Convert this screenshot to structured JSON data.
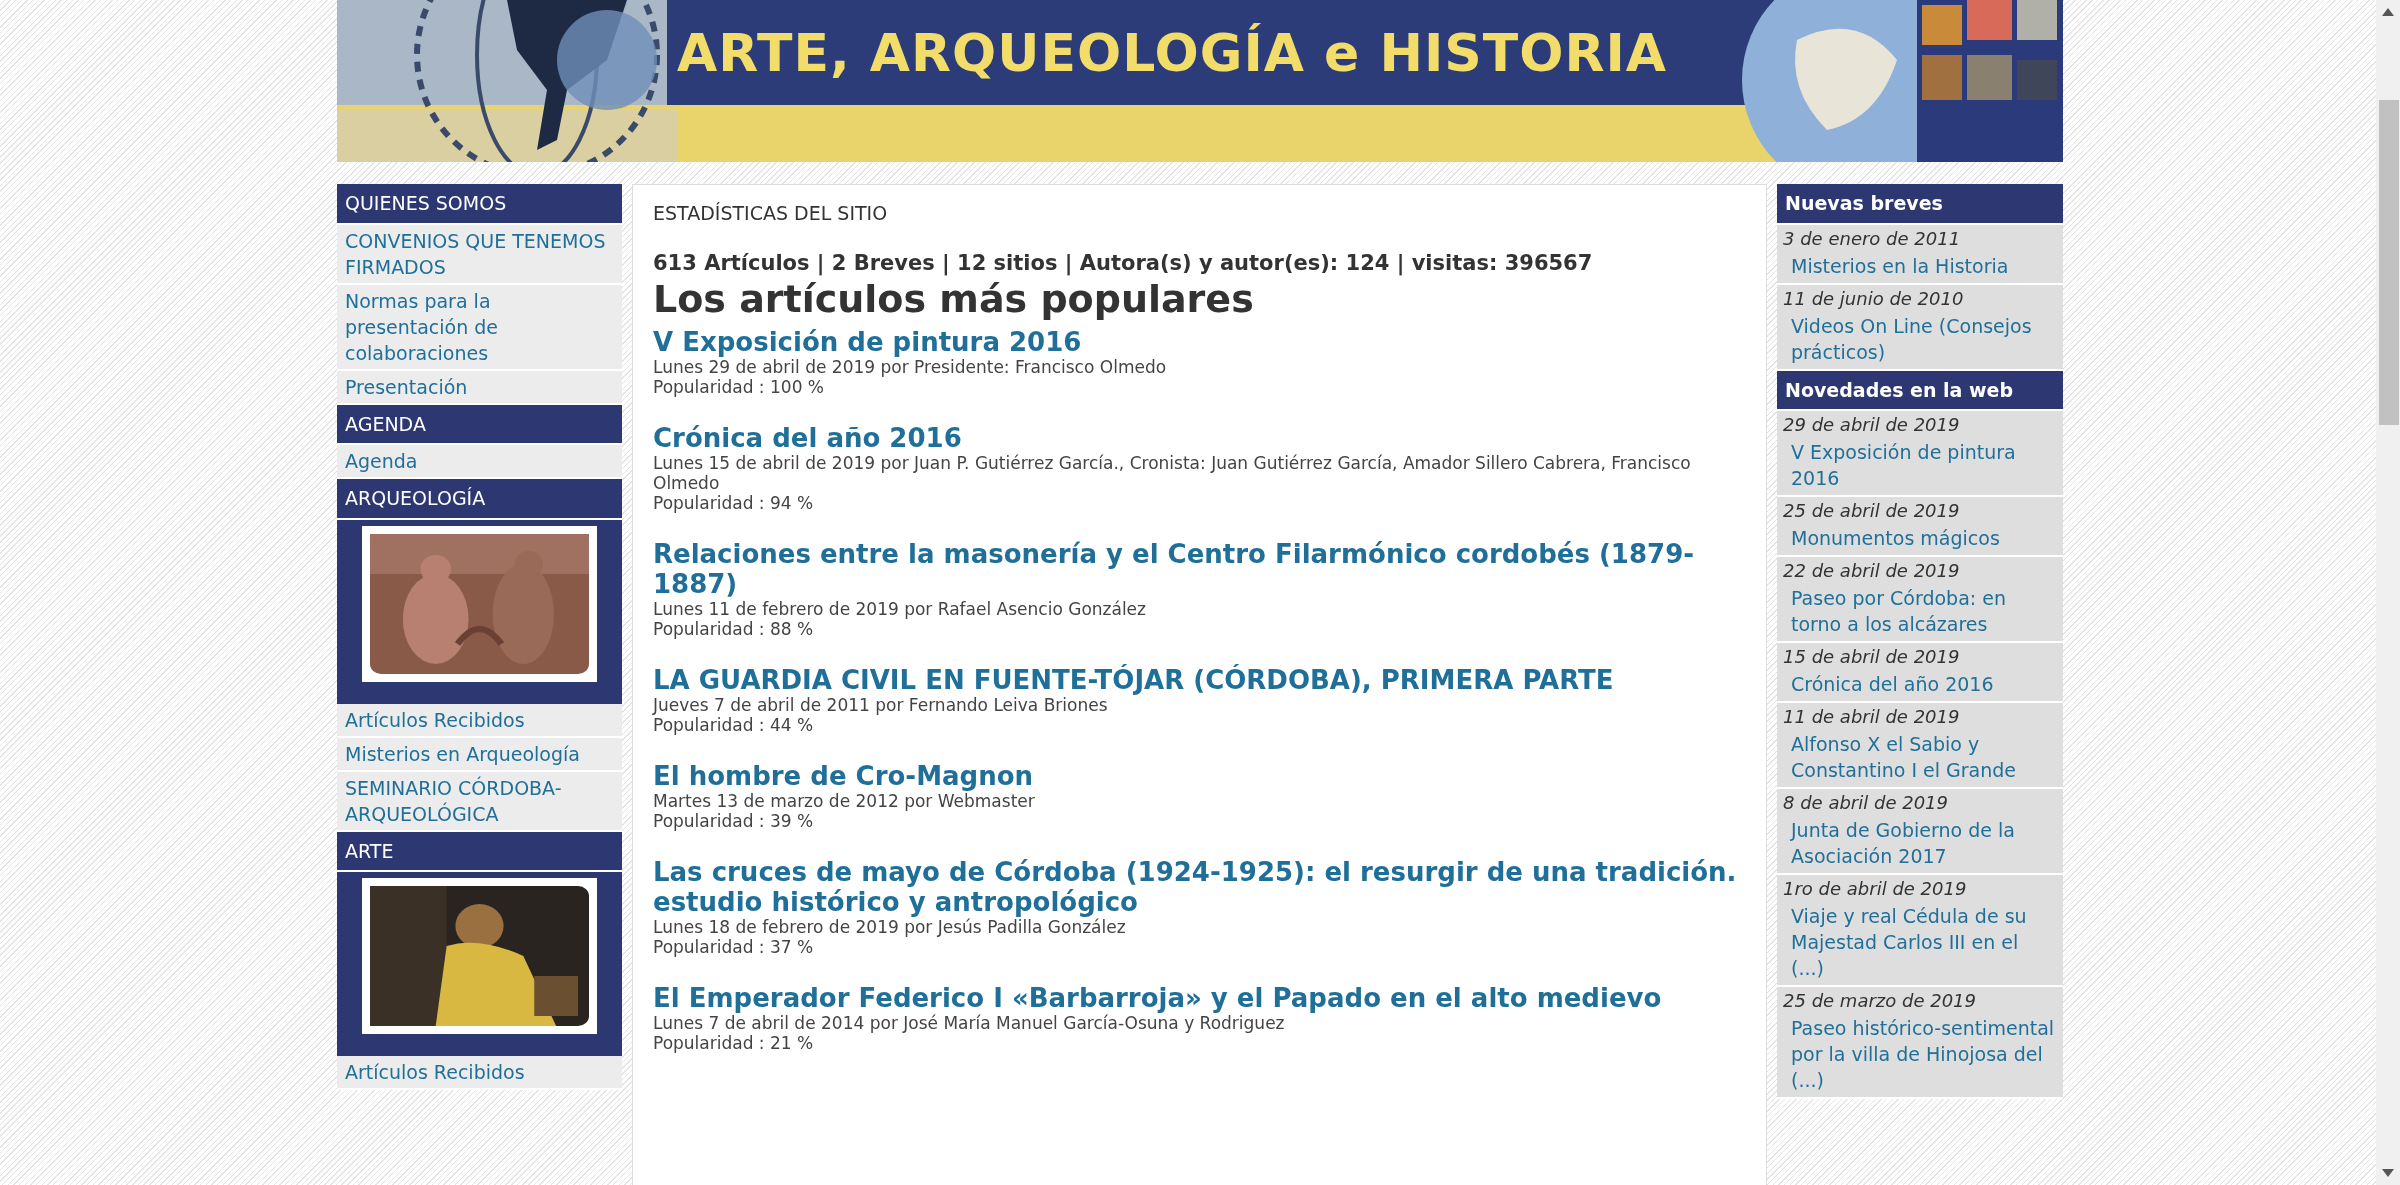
{
  "header": {
    "title": "ARTE, ARQUEOLOGÍA e HISTORIA",
    "image": {
      "kind": "picture"
    }
  },
  "left_sidebar": {
    "sections": [
      {
        "title": "QUIENES SOMOS",
        "items": [
          "CONVENIOS QUE TENEMOS FIRMADOS",
          "Normas para la presentación de colaboraciones",
          "Presentación"
        ]
      },
      {
        "title": "AGENDA",
        "items": [
          "Agenda"
        ]
      },
      {
        "title": "ARQUEOLOGÍA",
        "image": {
          "kind": "picture"
        },
        "items": [
          "Artículos Recibidos",
          "Misterios en Arqueología",
          "SEMINARIO CÓRDOBA-ARQUEOLÓGICA"
        ]
      },
      {
        "title": "ARTE",
        "image": {
          "kind": "picture"
        },
        "items": [
          "Artículos Recibidos"
        ]
      }
    ]
  },
  "main": {
    "section_title": "ESTADÍSTICAS DEL SITIO",
    "stats": "613 Artículos | 2 Breves | 12 sitios | Autora(s) y autor(es): 124 | visitas: 396567",
    "heading": "Los artículos más populares",
    "articles": [
      {
        "title": "V Exposición de pintura 2016",
        "byline": "Lunes 29 de abril de 2019 por Presidente: Francisco Olmedo",
        "popularity": "Popularidad : 100 %"
      },
      {
        "title": "Crónica del año 2016",
        "byline": "Lunes 15 de abril de 2019 por Juan P. Gutiérrez García., Cronista: Juan Gutiérrez García, Amador Sillero Cabrera, Francisco Olmedo",
        "popularity": "Popularidad : 94 %"
      },
      {
        "title": "Relaciones entre la masonería y el Centro Filarmónico cordobés (1879-1887)",
        "byline": "Lunes 11 de febrero de 2019 por Rafael Asencio González",
        "popularity": "Popularidad : 88 %"
      },
      {
        "title": "LA GUARDIA CIVIL EN FUENTE-TÓJAR (CÓRDOBA), PRIMERA PARTE",
        "byline": "Jueves 7 de abril de 2011 por Fernando Leiva Briones",
        "popularity": "Popularidad : 44 %"
      },
      {
        "title": "El hombre de Cro-Magnon",
        "byline": "Martes 13 de marzo de 2012 por Webmaster",
        "popularity": "Popularidad : 39 %"
      },
      {
        "title": "Las cruces de mayo de Córdoba (1924-1925): el resurgir de una tradición. estudio histórico y antropológico",
        "byline": "Lunes 18 de febrero de 2019 por Jesús Padilla González",
        "popularity": "Popularidad : 37 %"
      },
      {
        "title": "El Emperador Federico I «Barbarroja» y el Papado en el alto medievo",
        "byline": "Lunes 7 de abril de 2014 por José María Manuel García-Osuna y Rodriguez",
        "popularity": "Popularidad : 21 %"
      }
    ]
  },
  "right_sidebar": {
    "sections": [
      {
        "title": "Nuevas breves",
        "entries": [
          {
            "date": "3 de enero de 2011",
            "title": "Misterios en la Historia"
          },
          {
            "date": "11 de junio de 2010",
            "title": "Videos On Line (Consejos prácticos)"
          }
        ]
      },
      {
        "title": "Novedades en la web",
        "entries": [
          {
            "date": "29 de abril de 2019",
            "title": "V Exposición de pintura 2016"
          },
          {
            "date": "25 de abril de 2019",
            "title": "Monumentos mágicos"
          },
          {
            "date": "22 de abril de 2019",
            "title": "Paseo por Córdoba: en torno a los alcázares"
          },
          {
            "date": "15 de abril de 2019",
            "title": "Crónica del año 2016"
          },
          {
            "date": "11 de abril de 2019",
            "title": "Alfonso X el Sabio y Constantino I el Grande"
          },
          {
            "date": "8 de abril de 2019",
            "title": "Junta de Gobierno de la Asociación 2017"
          },
          {
            "date": "1ro de abril de 2019",
            "title": "Viaje y real Cédula de su Majestad Carlos III en el (...)"
          },
          {
            "date": "25 de marzo de 2019",
            "title": "Paseo histórico-sentimental por la villa de Hinojosa del (...)"
          }
        ]
      }
    ]
  }
}
